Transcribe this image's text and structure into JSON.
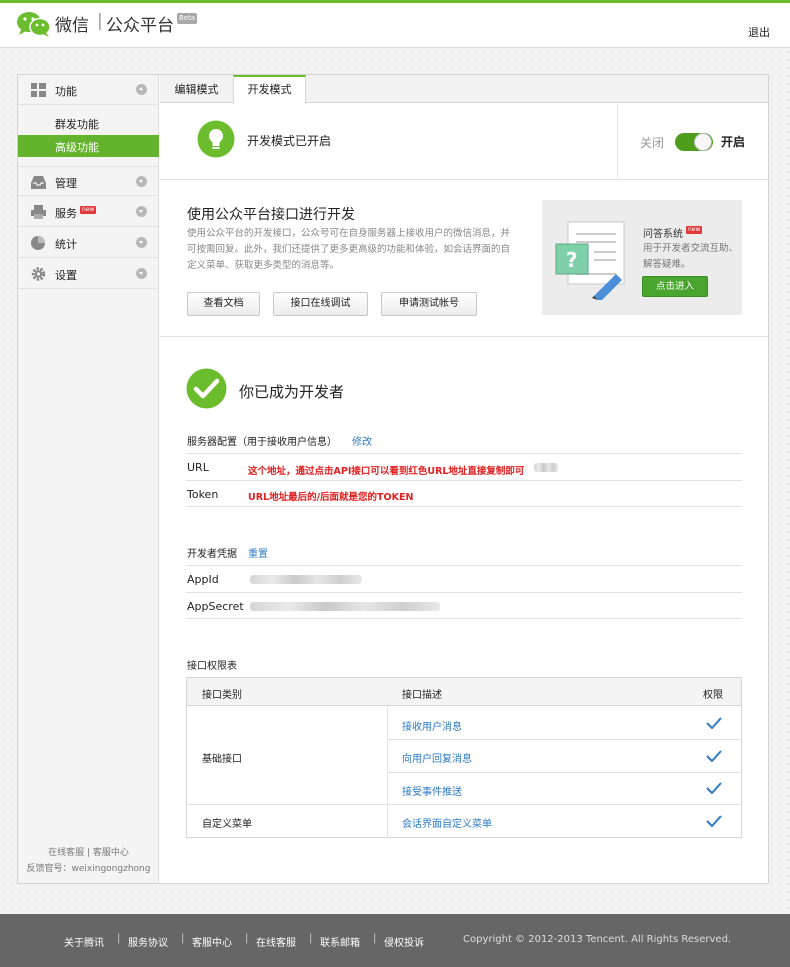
{
  "header": {
    "brand_name": "微信",
    "brand_sep": "|",
    "brand_sub": "公众平台",
    "beta_badge": "Beta",
    "logout": "退出"
  },
  "sidebar": {
    "groups": [
      {
        "label": "功能",
        "icon": "grid-icon",
        "expanded": true
      },
      {
        "label": "管理",
        "icon": "inbox-icon"
      },
      {
        "label": "服务",
        "icon": "printer-icon",
        "badge": "new"
      },
      {
        "label": "统计",
        "icon": "pie-chart-icon"
      },
      {
        "label": "设置",
        "icon": "gear-icon"
      }
    ],
    "sub_items": [
      {
        "label": "群发功能"
      },
      {
        "label": "高级功能",
        "active": true
      }
    ],
    "footer_line1": "在线客服 | 客服中心",
    "footer_line2": "反馈官号：weixingongzhong"
  },
  "tabs": [
    "编辑模式",
    "开发模式"
  ],
  "status": {
    "text": "开发模式已开启",
    "off_label": "关闭",
    "on_label": "开启",
    "toggle_on": true
  },
  "api": {
    "title": "使用公众平台接口进行开发",
    "description": "使用公众平台的开发接口，公众号可在自身服务器上接收用户的微信消息，并可按需回复。此外，我们还提供了更多更高级的功能和体验，如会话界面的自定义菜单、获取更多类型的消息等。",
    "buttons": [
      "查看文档",
      "接口在线调试",
      "申请测试帐号"
    ]
  },
  "qa": {
    "title": "问答系统",
    "badge": "new",
    "description": "用于开发者交流互助、解答疑难。",
    "button": "点击进入"
  },
  "developer": {
    "title": "你已成为开发者",
    "server_config_label": "服务器配置（用于接收用户信息）",
    "server_config_link": "修改",
    "url_label": "URL",
    "url_note": "这个地址，通过点击API接口可以看到红色URL地址直接复制即可",
    "token_label": "Token",
    "token_note": "URL地址最后的/后面就是您的TOKEN",
    "credentials_label": "开发者凭据",
    "credentials_link": "重置",
    "appid_label": "AppId",
    "appsecret_label": "AppSecret"
  },
  "permissions": {
    "title": "接口权限表",
    "headers": [
      "接口类别",
      "接口描述",
      "权限"
    ],
    "groups": [
      {
        "category": "基础接口",
        "items": [
          "接收用户消息",
          "向用户回复消息",
          "接受事件推送"
        ]
      },
      {
        "category": "自定义菜单",
        "items": [
          "会话界面自定义菜单"
        ]
      }
    ]
  },
  "footer": {
    "links": [
      "关于腾讯",
      "服务协议",
      "客服中心",
      "在线客服",
      "联系邮箱",
      "侵权投诉"
    ],
    "separator": "|",
    "copyright": "Copyright © 2012-2013 Tencent. All Rights Reserved."
  },
  "colors": {
    "brand_green": "#6bbd2d",
    "active_nav": "#63b32c",
    "link_blue": "#2d7cc6",
    "note_red": "#e02020",
    "footer_bg": "#666666"
  }
}
